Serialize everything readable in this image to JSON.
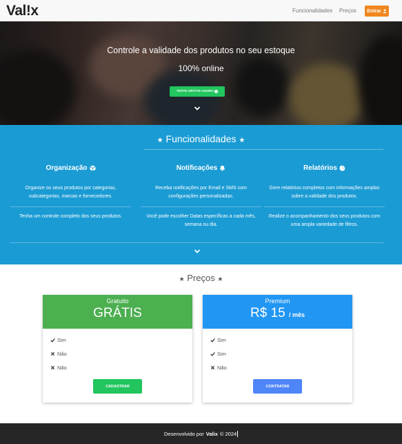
{
  "navbar": {
    "brand": "Val!x",
    "links": [
      "Funcionalidades",
      "Preços"
    ],
    "login_label": "Entrar",
    "login_icon": "user-icon",
    "accent": "#f0871e"
  },
  "hero": {
    "title": "Controle a validade dos produtos no seu estoque",
    "subtitle": "100% online",
    "cta_label": "TESTE GRÁTIS AGORA",
    "cta_icon": "play-circle-icon",
    "cta_color": "#22c55e",
    "scroll_icon": "chevron-down-icon"
  },
  "features": {
    "title": "Funcionalidades",
    "title_icon": "star-icon",
    "bg_color": "#1a9bd4",
    "columns": [
      {
        "heading": "Organização",
        "icon": "cube-icon",
        "text1": "Organize os seus produtos por categorias, subcategorias, marcas e fornecedores.",
        "text2": "Tenha um controle completo dos seus produtos."
      },
      {
        "heading": "Notificações",
        "icon": "bell-icon",
        "text1": "Receba notificações por Email e SMS com configurações personalizadas.",
        "text2": "Você pode escolher Datas específicas a cada mês, semana ou dia."
      },
      {
        "heading": "Relatórios",
        "icon": "pie-chart-icon",
        "text1": "Gere relatórios completos com informações amplas sobre a validade dos produtos.",
        "text2": "Realize o acompanhamento dos seus produtos com uma ampla variedade de filtros."
      }
    ],
    "scroll_icon": "chevron-down-icon"
  },
  "prices": {
    "title": "Preços",
    "title_icon": "star-icon",
    "plans": [
      {
        "name": "Gratuito",
        "price": "GRÁTIS",
        "per": "",
        "color": "#4caf50",
        "items": [
          {
            "icon": "check-icon",
            "label": "Sim"
          },
          {
            "icon": "times-icon",
            "label": "Não"
          },
          {
            "icon": "times-icon",
            "label": "Não"
          }
        ],
        "button": "CADASTRAR",
        "button_color": "#22c55e"
      },
      {
        "name": "Premium",
        "price": "R$ 15",
        "per": "/ mês",
        "color": "#2196f3",
        "items": [
          {
            "icon": "check-icon",
            "label": "Sim"
          },
          {
            "icon": "check-icon",
            "label": "Sim"
          },
          {
            "icon": "times-icon",
            "label": "Não"
          }
        ],
        "button": "CONTRATAR",
        "button_color": "#4f86f7"
      }
    ]
  },
  "footer": {
    "prefix": "Desenvolvido por",
    "brand": "Valix",
    "copyright": "© 2024"
  }
}
